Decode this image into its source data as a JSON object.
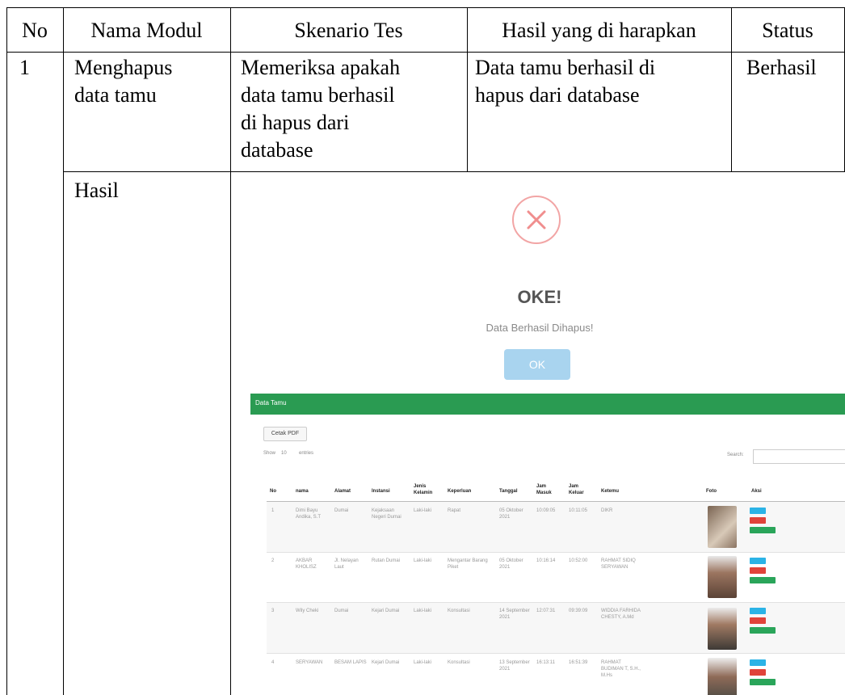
{
  "table": {
    "headers": [
      "No",
      "Nama Modul",
      "Skenario Tes",
      "Hasil yang di harapkan",
      "Status"
    ],
    "row": {
      "no": "1",
      "modul": [
        "Menghapus",
        "data tamu"
      ],
      "skenario": [
        "Memeriksa apakah",
        "data tamu berhasil",
        "di hapus dari",
        "database"
      ],
      "harapan": [
        "Data tamu berhasil di",
        "hapus dari database"
      ],
      "status": "Berhasil"
    },
    "hasil_label": "Hasil"
  },
  "screenshot": {
    "alert": {
      "icon": "error-x-icon",
      "title": "OKE!",
      "message": "Data Berhasil Dihapus!",
      "button": "OK"
    },
    "panel_title": "Data Tamu",
    "pdf_button": "Cetak PDF",
    "show_label": "Show",
    "show_value": "10",
    "entries_label": "entries",
    "search_label": "Search:",
    "columns": [
      "No",
      "nama",
      "Alamat",
      "Instansi",
      "Jenis Kelamin",
      "Keperluan",
      "Tanggal",
      "Jam Masuk",
      "Jam Keluar",
      "Ketemu",
      "Foto",
      "Aksi"
    ],
    "rows": [
      [
        "1",
        "Dimi Bayu Andika, S.T",
        "Dumai",
        "Kejaksaan Negeri Dumai",
        "Laki-laki",
        "Rapat",
        "05 Oktober 2021",
        "10:09:05",
        "10:11:05",
        "DIKR"
      ],
      [
        "2",
        "AKBAR KHOLISZ",
        "Jl. Nelayan Laut",
        "Rutan Dumai",
        "Laki-laki",
        "Mengantar Barang Piket",
        "05 Oktober 2021",
        "10:16:14",
        "10:52:00",
        "RAHMAT SIDIQ SERYAWAN"
      ],
      [
        "3",
        "Wily Cheki",
        "Dumai",
        "Kejari Dumai",
        "Laki-laki",
        "Konsultasi",
        "14 September 2021",
        "12:07:31",
        "09:39:09",
        "WIDDIA FARHIDA CHESTY, A.Md"
      ],
      [
        "4",
        "SERYAWAN",
        "BESAM LAPIS",
        "Kejari Dumai",
        "Laki-laki",
        "Konsultasi",
        "13 September 2021",
        "16:13:11",
        "16:51:39",
        "RAHMAT BUDIMAN T, S.H., M.Hs"
      ]
    ],
    "actions": [
      "Ubah",
      "Hapus",
      "Kirim WA"
    ],
    "colors": {
      "panel": "#2a9b52",
      "ok_button": "#a9d4ef",
      "error_ring": "#f2a5a5",
      "edit": "#2bb3e6",
      "delete": "#e0433a",
      "wa": "#2aa55a"
    }
  }
}
